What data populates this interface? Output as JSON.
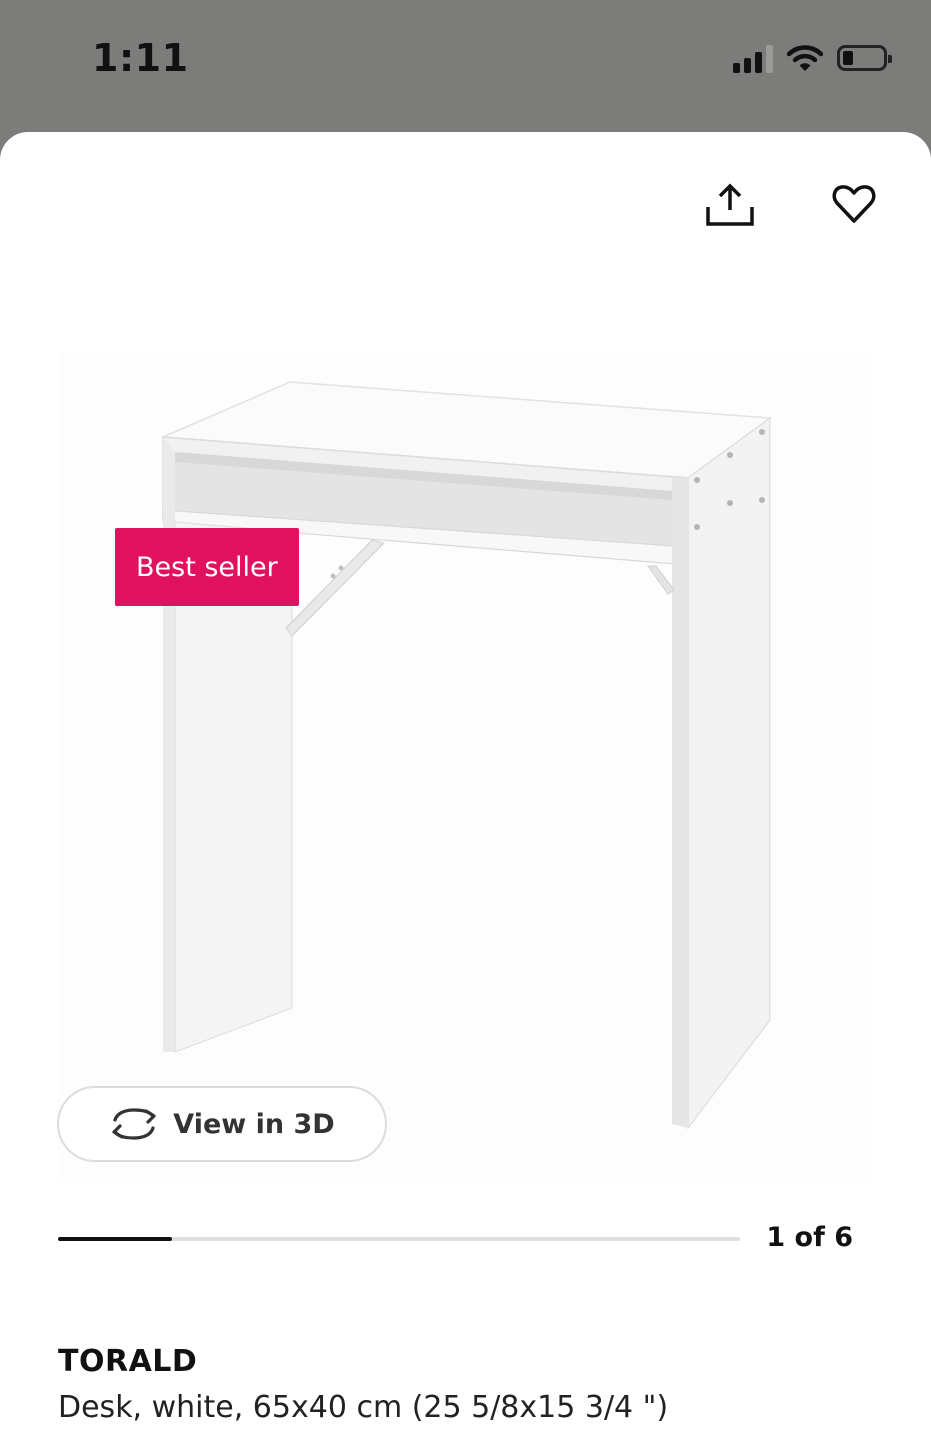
{
  "status_bar": {
    "time": "1:11",
    "battery_level": 0.25,
    "signal_bars_active": 3,
    "signal_bars_total": 4
  },
  "toolbar": {
    "share_icon": "share-icon",
    "favorite_icon": "heart-icon"
  },
  "product_image": {
    "badge": "Best seller",
    "badge_color": "#e0115f"
  },
  "view_3d": {
    "label": "View in 3D",
    "icon": "rotate-3d-icon"
  },
  "gallery": {
    "counter": "1 of 6",
    "current": 1,
    "total": 6
  },
  "product": {
    "name": "TORALD",
    "description": "Desk, white, 65x40 cm (25 5/8x15 3/4 \")"
  }
}
